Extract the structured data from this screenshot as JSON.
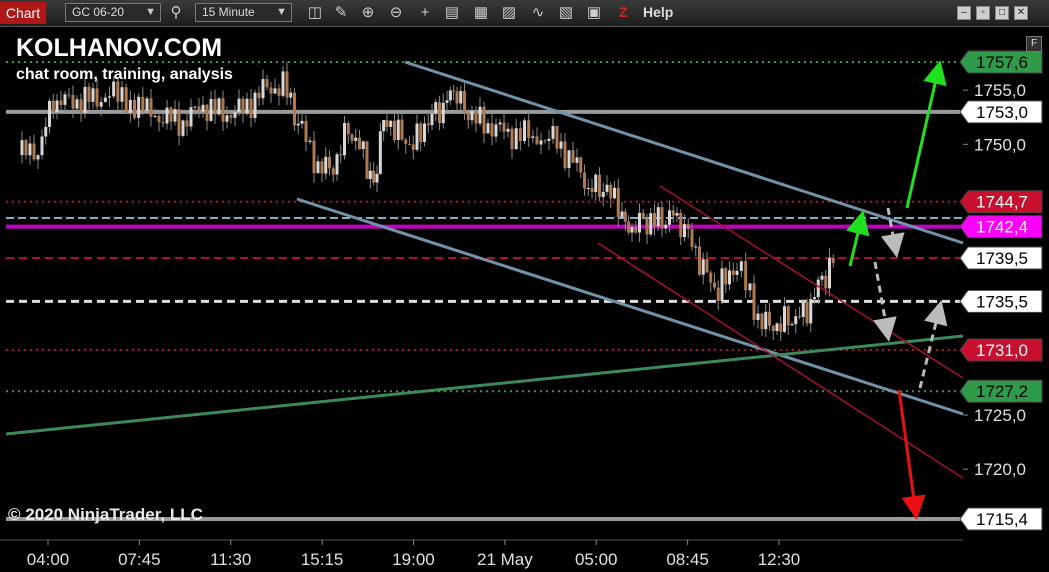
{
  "toolbar": {
    "chart_tab": "Chart",
    "instrument": "GC 06-20",
    "interval": "15 Minute",
    "help": "Help",
    "z_label": "Z"
  },
  "watermark": {
    "title": "KOLHANOV.COM",
    "subtitle": "chat room, training, analysis",
    "copyright": "© 2020 NinjaTrader, LLC",
    "f_button": "F"
  },
  "colors": {
    "background": "#000000",
    "channel": "#6f93a8",
    "green_trend": "#3a8a5a",
    "red_channel": "#a8102a",
    "magenta": "#c000c0",
    "green_arrow": "#1ee01e",
    "red_arrow": "#e81010",
    "grey_arrow": "#bbbbbb"
  },
  "chart_data": {
    "type": "candlestick",
    "instrument": "GC 06-20",
    "interval": "15 Minute",
    "x_ticks": [
      "04:00",
      "07:45",
      "11:30",
      "15:15",
      "19:00",
      "21 May",
      "05:00",
      "08:45",
      "12:30"
    ],
    "y_ticks": [
      "1755,0",
      "1750,0",
      "1725,0",
      "1720,0"
    ],
    "ylim": [
      1714.5,
      1760.5
    ],
    "price_levels": [
      {
        "label": "1757,6",
        "value": 1757.6,
        "style": "dotted",
        "color": "#2e9a4a",
        "badge_bg": "#2e9a4a",
        "badge_fg": "#000000"
      },
      {
        "label": "1753,0",
        "value": 1753.0,
        "style": "solid",
        "color": "#9a9a9a",
        "badge_bg": "#ffffff",
        "badge_fg": "#000000"
      },
      {
        "label": "1744,7",
        "value": 1744.7,
        "style": "dotted",
        "color": "#b01030",
        "badge_bg": "#c8102e",
        "badge_fg": "#ffffff"
      },
      {
        "label": "1742,4",
        "value": 1742.4,
        "style": "solid",
        "color": "#c000c0",
        "badge_bg": "#ff00ff",
        "badge_fg": "#ffffff"
      },
      {
        "label": "1739,5",
        "value": 1739.5,
        "style": "dashed",
        "color": "#b01030",
        "badge_bg": "#ffffff",
        "badge_fg": "#000000"
      },
      {
        "label": "1735,5",
        "value": 1735.5,
        "style": "dashed",
        "color": "#dddddd",
        "badge_bg": "#ffffff",
        "badge_fg": "#000000"
      },
      {
        "label": "1731,0",
        "value": 1731.0,
        "style": "dotted",
        "color": "#b01030",
        "badge_bg": "#c8102e",
        "badge_fg": "#ffffff"
      },
      {
        "label": "1727,2",
        "value": 1727.2,
        "style": "dotted",
        "color": "#2e9a4a",
        "badge_bg": "#2e9a4a",
        "badge_fg": "#000000"
      },
      {
        "label": "1715,4",
        "value": 1715.4,
        "style": "solid",
        "color": "#9a9a9a",
        "badge_bg": "#ffffff",
        "badge_fg": "#000000"
      }
    ],
    "blue_reference_line": 1743.2
  }
}
